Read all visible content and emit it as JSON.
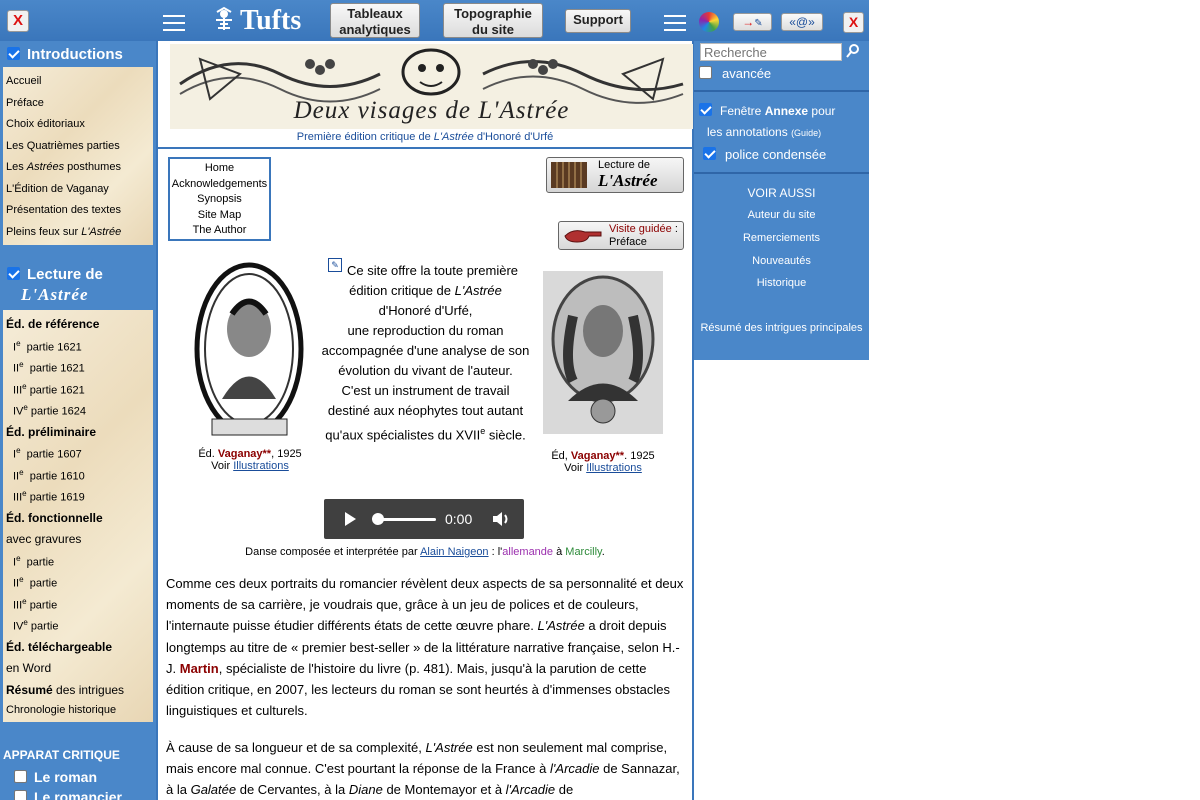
{
  "topbar": {
    "close_left": "X",
    "logo_text": "Tufts",
    "btn_tableaux": [
      "Tableaux",
      "analytiques"
    ],
    "btn_topo": [
      "Topographie",
      "du site"
    ],
    "btn_support": "Support",
    "arrow_btn": "→",
    "email_btn": "«@»",
    "close_right": "X"
  },
  "left": {
    "intro_head": "Introductions",
    "intro_items": [
      "Accueil",
      "Préface",
      "Choix éditoriaux",
      "Les Quatrièmes parties",
      "L'Édition de Vaganay",
      "Présentation des textes"
    ],
    "les_astrees": [
      "Les ",
      "Astrées",
      " posthumes"
    ],
    "pleins_feux": [
      "Pleins feux sur ",
      "L'Astrée"
    ],
    "lecture_head": "Lecture de",
    "lecture_sub": "L'Astrée",
    "ed_ref": "Éd. de référence",
    "ed_ref_items": [
      {
        "num": "I",
        "label": "partie 1621"
      },
      {
        "num": "II",
        "label": "partie 1621"
      },
      {
        "num": "III",
        "label": "partie 1621"
      },
      {
        "num": "IV",
        "label": "partie 1624"
      }
    ],
    "ed_prelim": "Éd. préliminaire",
    "ed_prelim_items": [
      {
        "num": "I",
        "label": "partie 1607"
      },
      {
        "num": "II",
        "label": "partie 1610"
      },
      {
        "num": "III",
        "label": "partie 1619"
      }
    ],
    "ed_fonc": "Éd. fonctionnelle",
    "avec_gravures": "avec gravures",
    "fonc_items": [
      {
        "num": "I",
        "label": "partie"
      },
      {
        "num": "II",
        "label": "partie"
      },
      {
        "num": "III",
        "label": "partie"
      },
      {
        "num": "IV",
        "label": "partie"
      }
    ],
    "ed_tel": "Éd. téléchargeable",
    "en_word": "en Word",
    "resume_bold": "Résumé",
    "resume_rest": " des intrigues",
    "chrono": "Chronologie historique",
    "apparat": "APPARAT CRITIQUE",
    "le_roman": "Le roman",
    "le_romancier": "Le romancier",
    "sup_e": "e"
  },
  "center": {
    "banner_title": "Deux visages de L'Astrée",
    "subtitle_pre": "Première édition critique de ",
    "subtitle_it": "L'Astrée",
    "subtitle_post": " d'Honoré d'Urfé",
    "mininav": [
      "Home",
      "Acknowledgements",
      "Synopsis",
      "Site Map",
      "The Author"
    ],
    "lecture_btn_small": "Lecture de",
    "lecture_btn_big": "L'Astrée",
    "visite_label": "Visite guidée",
    "visite_colon": " :",
    "visite_sub": "Préface",
    "intro_lines": {
      "l1": "Ce site offre la toute première",
      "l2_pre": "édition critique de ",
      "l2_it": "L'Astrée",
      "l3": "d'Honoré d'Urfé,",
      "l4": "une reproduction du roman",
      "l5": "accompagnée d'une analyse de son",
      "l6": "évolution du vivant de l'auteur.",
      "l7": "C'est un instrument de travail",
      "l8": "destiné aux néophytes tout autant",
      "l9_pre": "qu'aux spécialistes du XVII",
      "l9_sup": "e",
      "l9_post": " siècle."
    },
    "cap_left": {
      "pre": "Éd. ",
      "bold": "Vaganay**",
      "post": ", 1925",
      "voir": "Voir ",
      "link": "Illustrations"
    },
    "cap_right": {
      "pre": "Éd, ",
      "bold": "Vaganay**",
      "post": ". 1925",
      "voir": "Voir ",
      "link": "Illustrations"
    },
    "audio_time": "0:00",
    "dance": {
      "pre": "Danse composée et interprétée par ",
      "link": "Alain Naigeon",
      "mid": " : l'",
      "allemande": "allemande",
      "a": " à ",
      "marcilly": "Marcilly",
      "end": "."
    },
    "para1": {
      "t1": "Comme ces deux portraits du romancier révèlent deux aspects de sa personnalité et deux moments de sa carrière, je voudrais que, grâce à un jeu de polices et de couleurs, l'internaute puisse étudier différents états de cette œuvre phare. ",
      "it1": "L'Astrée",
      "t2": " a droit depuis longtemps au titre de « premier best-seller » de la littérature narrative française, selon H.-J. ",
      "martin": "Martin",
      "t3": ", spécialiste de l'histoire du livre (p. 481). Mais, jusqu'à la parution de cette édition critique, en 2007, les lecteurs du roman se sont heurtés à d'immenses obstacles linguistiques et culturels."
    },
    "para2": {
      "t1": "À cause de sa longueur et de sa complexité, ",
      "it1": "L'Astrée",
      "t2": " est non seulement mal comprise, mais encore mal connue. C'est pourtant la réponse de la France à ",
      "it2": "l'Arcadie",
      "t3": " de Sannazar, à la ",
      "it3": "Galatée",
      "t4": " de Cervantes, à la ",
      "it4": "Diane",
      "t5": " de Montemayor et à ",
      "it5": "l'Arcadie",
      "t6": " de"
    }
  },
  "right": {
    "search_placeholder": "Recherche",
    "avancee": "avancée",
    "fenetre_pre": "Fenêtre ",
    "fenetre_bold": "Annexe",
    "fenetre_post": " pour",
    "annotations": "les annotations ",
    "guide": "(Guide)",
    "police": "police condensée",
    "voir_aussi": "VOIR AUSSI",
    "links": [
      "Auteur du site",
      "Remerciements",
      "Nouveautés",
      "Historique"
    ],
    "resume": "Résumé des intrigues principales"
  },
  "colors": {
    "blue": "#4a87c9",
    "dark_red": "#8b0000",
    "link": "#1a4d9a",
    "allemande": "#9b2fae",
    "marcilly": "#2e8b3a"
  }
}
